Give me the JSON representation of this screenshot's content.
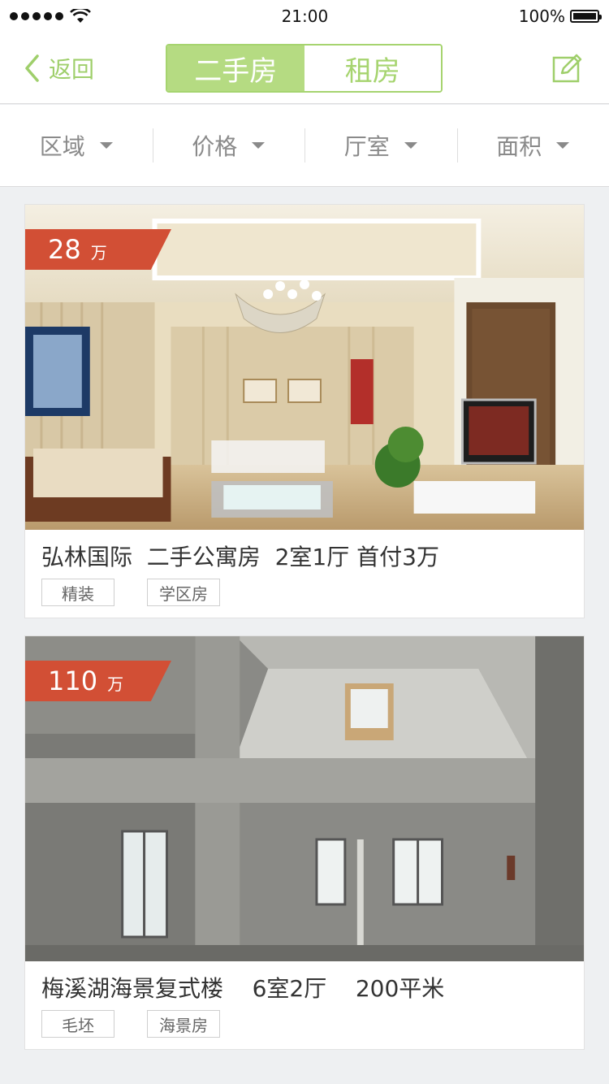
{
  "status": {
    "time": "21:00",
    "battery": "100%"
  },
  "nav": {
    "back_label": "返回",
    "tabs": [
      {
        "label": "二手房",
        "active": true
      },
      {
        "label": "租房",
        "active": false
      }
    ],
    "accent_color": "#a6d46f"
  },
  "filters": [
    {
      "label": "区域"
    },
    {
      "label": "价格"
    },
    {
      "label": "厅室"
    },
    {
      "label": "面积"
    }
  ],
  "listings": [
    {
      "price": "28",
      "unit": "万",
      "title": "弘林国际  二手公寓房  2室1厅 首付3万",
      "tags": [
        "精装",
        "学区房"
      ]
    },
    {
      "price": "110",
      "unit": "万",
      "title": "梅溪湖海景复式楼    6室2厅    200平米",
      "tags": [
        "毛坯",
        "海景房"
      ]
    }
  ]
}
